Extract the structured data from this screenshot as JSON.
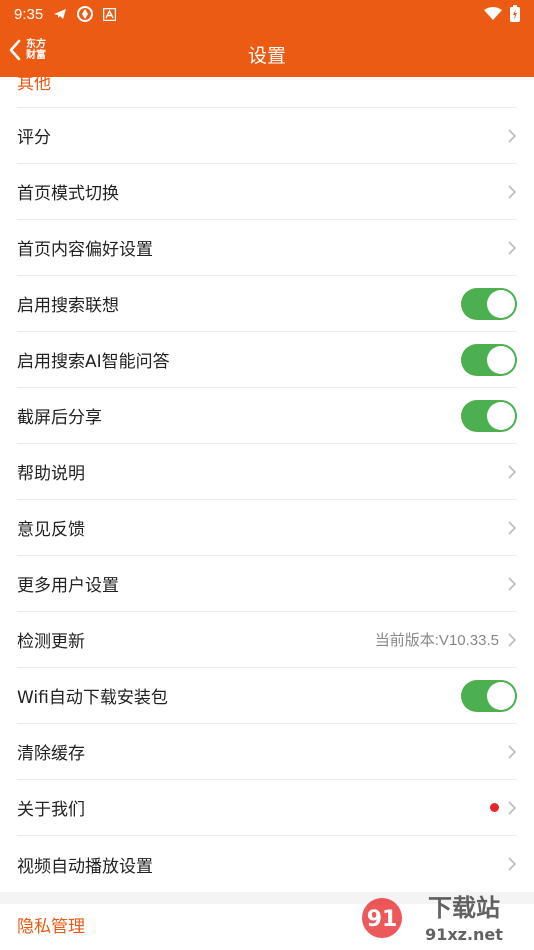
{
  "status_bar": {
    "time": "9:35",
    "icons": [
      "telegram-icon",
      "sync-icon",
      "text-app-icon",
      "wifi-icon",
      "battery-icon"
    ]
  },
  "app_bar": {
    "title": "设置",
    "brand_line1": "东方",
    "brand_line2": "财富"
  },
  "sections": {
    "other_title": "其他",
    "privacy_title": "隐私管理"
  },
  "rows": [
    {
      "label": "评分",
      "type": "chevron"
    },
    {
      "label": "首页模式切换",
      "type": "chevron"
    },
    {
      "label": "首页内容偏好设置",
      "type": "chevron"
    },
    {
      "label": "启用搜索联想",
      "type": "toggle",
      "on": true
    },
    {
      "label": "启用搜索AI智能问答",
      "type": "toggle",
      "on": true
    },
    {
      "label": "截屏后分享",
      "type": "toggle",
      "on": true
    },
    {
      "label": "帮助说明",
      "type": "chevron"
    },
    {
      "label": "意见反馈",
      "type": "chevron"
    },
    {
      "label": "更多用户设置",
      "type": "chevron"
    },
    {
      "label": "检测更新",
      "type": "chevron",
      "value": "当前版本:V10.33.5"
    },
    {
      "label": "Wifi自动下载安装包",
      "type": "toggle",
      "on": true
    },
    {
      "label": "清除缓存",
      "type": "chevron"
    },
    {
      "label": "关于我们",
      "type": "chevron",
      "badge": "red-dot"
    },
    {
      "label": "视频自动播放设置",
      "type": "chevron"
    }
  ],
  "watermark": {
    "line1": "下载站",
    "line2": "91xz.net"
  },
  "colors": {
    "brand": "#ec5b13",
    "toggle_on": "#4caf50",
    "divider": "#ececec",
    "badge": "#e8262a"
  }
}
